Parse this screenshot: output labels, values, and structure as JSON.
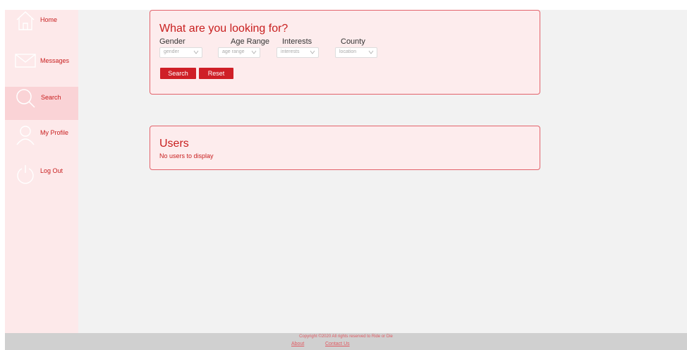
{
  "nav": {
    "items": [
      {
        "label": "Home",
        "icon": "home-icon"
      },
      {
        "label": "Messages",
        "icon": "envelope-icon"
      },
      {
        "label": "Search",
        "icon": "search-icon",
        "active": true
      },
      {
        "label": "My Profile",
        "icon": "user-icon"
      },
      {
        "label": "Log Out",
        "icon": "power-icon"
      }
    ]
  },
  "search": {
    "title": "What are you looking for?",
    "filters": [
      {
        "label": "Gender",
        "placeholder": "gender"
      },
      {
        "label": "Age Range",
        "placeholder": "age range"
      },
      {
        "label": "Interests",
        "placeholder": "interests"
      },
      {
        "label": "County",
        "placeholder": "location"
      }
    ],
    "search_button": "Search",
    "reset_button": "Reset"
  },
  "users": {
    "title": "Users",
    "empty_message": "No users to display"
  },
  "footer": {
    "copyright": "Copyright ©2020 All rights reserved to Ride or Die",
    "about_link": "About",
    "contact_link": "Contact Us"
  },
  "colors": {
    "accent": "#c81e1e",
    "button": "#cf1f27",
    "sidebar_bg": "#fde9ea",
    "sidebar_active": "#fad3d6",
    "card_bg": "#fdeced",
    "card_border": "#e3636b",
    "footer_bg": "#d0d0d0"
  }
}
